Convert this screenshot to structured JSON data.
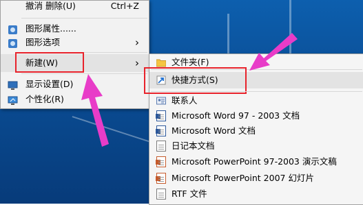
{
  "context_menu": {
    "items": [
      {
        "label": "撤消 删除(U)",
        "shortcut": "Ctrl+Z"
      },
      {
        "label": "图形属性......"
      },
      {
        "label": "图形选项",
        "submenu_arrow": "›"
      },
      {
        "label": "新建(W)",
        "submenu_arrow": "›"
      },
      {
        "label": "显示设置(D)"
      },
      {
        "label": "个性化(R)"
      }
    ]
  },
  "new_submenu": {
    "items": [
      {
        "label": "文件夹(F)",
        "icon": "folder-icon"
      },
      {
        "label": "快捷方式(S)",
        "icon": "shortcut-icon"
      },
      {
        "label": "联系人",
        "icon": "contact-icon"
      },
      {
        "label": "Microsoft Word 97 - 2003 文档",
        "icon": "word-icon"
      },
      {
        "label": "Microsoft Word 文档",
        "icon": "word-icon"
      },
      {
        "label": "日记本文档",
        "icon": "journal-icon"
      },
      {
        "label": "Microsoft PowerPoint 97-2003 演示文稿",
        "icon": "powerpoint-icon"
      },
      {
        "label": "Microsoft PowerPoint 2007 幻灯片",
        "icon": "powerpoint-icon"
      },
      {
        "label": "RTF 文件",
        "icon": "rtf-icon"
      }
    ]
  },
  "colors": {
    "highlight_box": "#e8222b",
    "annotation_arrow": "#e83cc8",
    "desktop_bg": "#0a4c93"
  }
}
